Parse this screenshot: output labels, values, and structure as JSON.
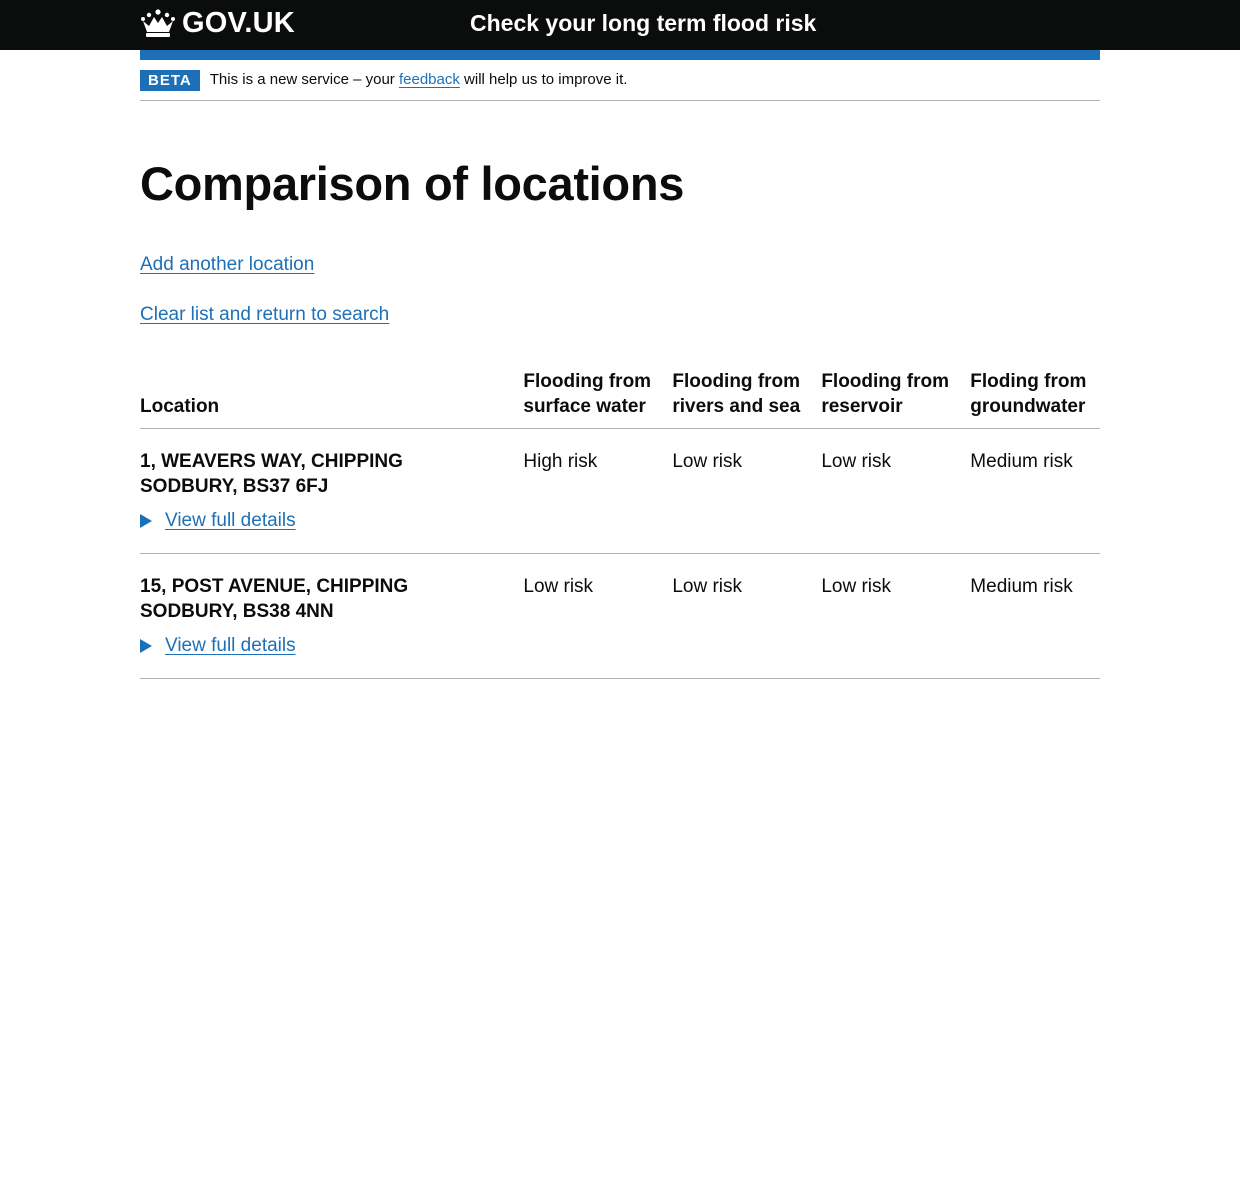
{
  "header": {
    "logo_text": "GOV.UK",
    "logo_icon": "crown-icon",
    "service_name": "Check your long term flood risk"
  },
  "phase_banner": {
    "tag": "BETA",
    "text_before": "This is a new service – your ",
    "link": "feedback",
    "text_after": " will help us to improve it."
  },
  "page": {
    "title": "Comparison of locations",
    "add_link": "Add another location",
    "clear_link": "Clear list and return to search"
  },
  "table": {
    "headers": [
      "Location",
      "Flooding from surface water",
      "Flooding from rivers and sea",
      "Flooding from reservoir",
      "Floding from groundwater"
    ],
    "rows": [
      {
        "address": "1, WEAVERS WAY, CHIPPING SODBURY, BS37 6FJ",
        "details_label": "View full details",
        "surface_water": "High risk",
        "rivers_sea": "Low risk",
        "reservoir": "Low risk",
        "groundwater": "Medium risk"
      },
      {
        "address": "15, POST AVENUE, CHIPPING SODBURY, BS38 4NN",
        "details_label": "View full details",
        "surface_water": "Low risk",
        "rivers_sea": "Low risk",
        "reservoir": "Low risk",
        "groundwater": "Medium risk"
      }
    ]
  },
  "colors": {
    "header_bg": "#0b0c0c",
    "brand_blue": "#1d70b8",
    "link": "#1d70b8",
    "border": "#b1b4b6",
    "text": "#0b0c0c"
  }
}
